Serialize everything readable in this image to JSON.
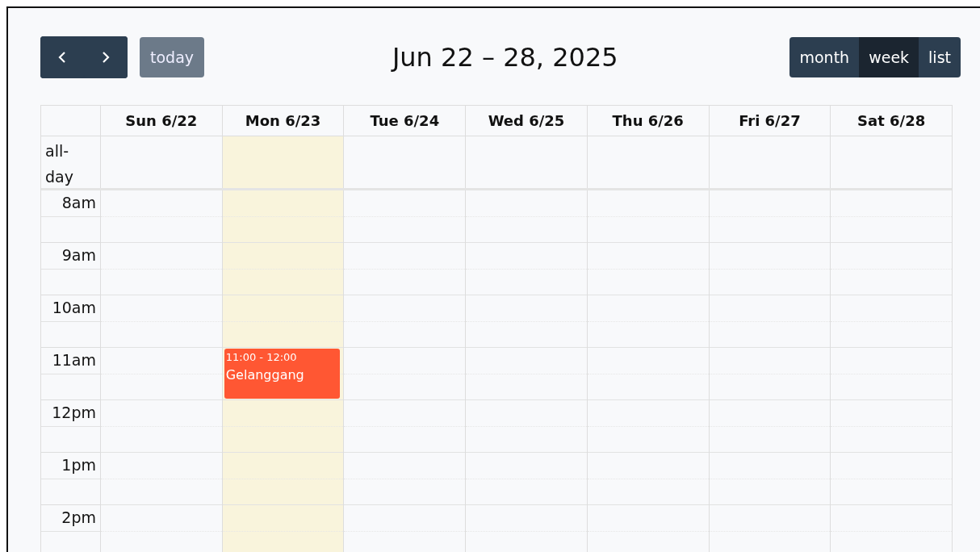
{
  "toolbar": {
    "today_button": {
      "label": "today",
      "disabled": true
    },
    "title": "Jun 22 – 28, 2025",
    "views": [
      {
        "label": "month",
        "selected": false
      },
      {
        "label": "week",
        "selected": true
      },
      {
        "label": "list",
        "selected": false
      }
    ]
  },
  "all_day_label": "all-day",
  "days": [
    {
      "label": "Sun 6/22",
      "today": false
    },
    {
      "label": "Mon 6/23",
      "today": true,
      "events": [
        {
          "time": "11:00 - 12:00",
          "title": "Gelanggang"
        }
      ]
    },
    {
      "label": "Tue 6/24",
      "today": false
    },
    {
      "label": "Wed 6/25",
      "today": false
    },
    {
      "label": "Thu 6/26",
      "today": false
    },
    {
      "label": "Fri 6/27",
      "today": false
    },
    {
      "label": "Sat 6/28",
      "today": false
    }
  ],
  "hours": [
    "8am",
    "9am",
    "10am",
    "11am",
    "12pm",
    "1pm",
    "2pm"
  ]
}
